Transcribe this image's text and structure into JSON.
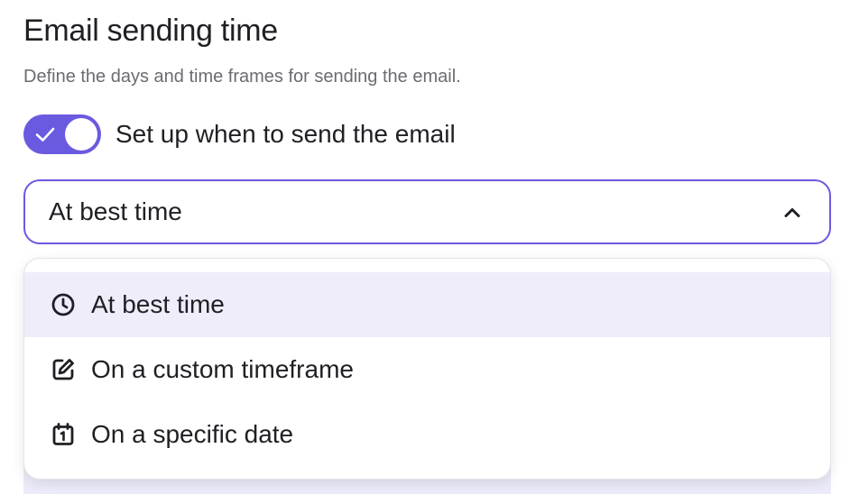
{
  "section": {
    "title": "Email sending time",
    "subtitle": "Define the days and time frames for sending the email."
  },
  "toggle": {
    "label": "Set up when to send the email",
    "checked": true,
    "color": "#6a5ae0"
  },
  "select": {
    "value": "At best time",
    "expanded": true,
    "icon": "chevron-up-icon"
  },
  "menu": {
    "items": [
      {
        "label": "At best time",
        "icon": "clock-icon",
        "selected": true
      },
      {
        "label": "On a custom timeframe",
        "icon": "edit-icon",
        "selected": false
      },
      {
        "label": "On a specific date",
        "icon": "calendar-icon",
        "selected": false
      }
    ]
  },
  "colors": {
    "accent": "#6a5ae0",
    "selected_bg": "#efedf9",
    "text": "#1f1f24",
    "muted": "#6b6b72"
  }
}
